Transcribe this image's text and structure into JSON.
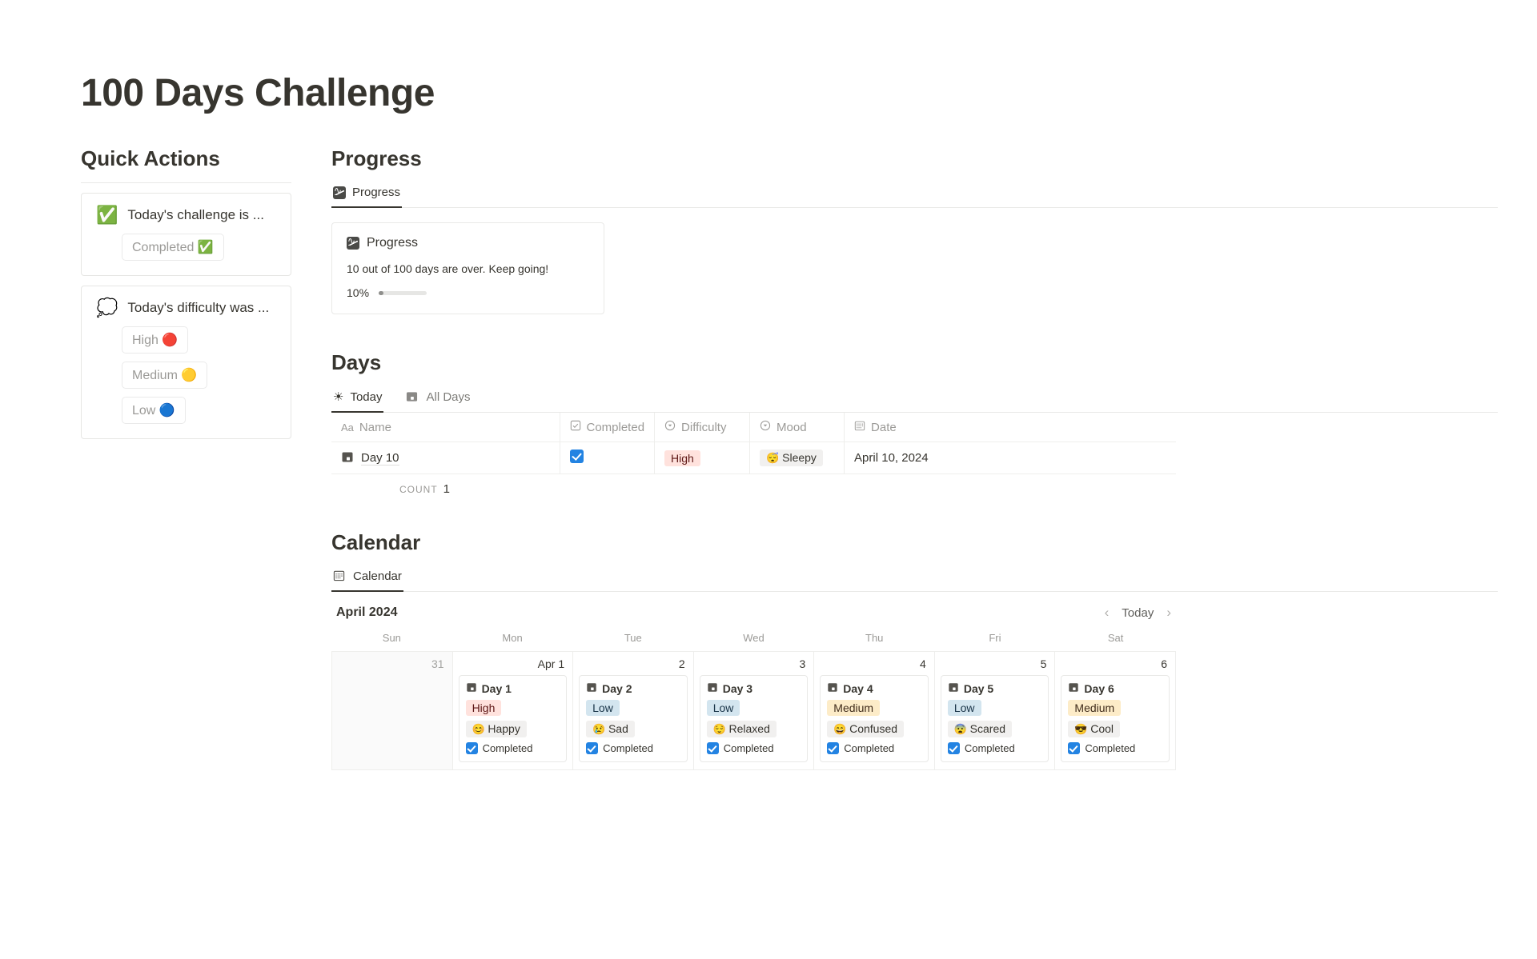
{
  "page_title": "100 Days Challenge",
  "quick_actions": {
    "heading": "Quick Actions",
    "cards": [
      {
        "emoji": "✅",
        "icon_name": "check-mark-emoji",
        "title": "Today's challenge is ...",
        "buttons": [
          {
            "label": "Completed ✅"
          }
        ]
      },
      {
        "emoji": "💭",
        "icon_name": "thought-balloon-emoji",
        "title": "Today's difficulty was ...",
        "buttons": [
          {
            "label": "High 🔴"
          },
          {
            "label": "Medium 🟡"
          },
          {
            "label": "Low 🔵"
          }
        ]
      }
    ]
  },
  "progress": {
    "heading": "Progress",
    "tabs": [
      {
        "label": "Progress",
        "icon": "chart-icon",
        "active": true
      }
    ],
    "card": {
      "title": "Progress",
      "icon": "chart-icon",
      "description": "10 out of 100 days are over. Keep going!",
      "percent_label": "10%",
      "percent_value": 10
    }
  },
  "days": {
    "heading": "Days",
    "tabs": [
      {
        "label": "Today",
        "icon": "sun-icon",
        "active": true
      },
      {
        "label": "All Days",
        "icon": "calendar-icon",
        "active": false
      }
    ],
    "columns": [
      {
        "label": "Name",
        "icon": "text-icon"
      },
      {
        "label": "Completed",
        "icon": "checkbox-icon"
      },
      {
        "label": "Difficulty",
        "icon": "select-icon"
      },
      {
        "label": "Mood",
        "icon": "select-icon"
      },
      {
        "label": "Date",
        "icon": "calendar-icon"
      }
    ],
    "rows": [
      {
        "name": "Day 10",
        "completed": true,
        "difficulty": "High",
        "difficulty_style": "high",
        "mood_emoji": "😴",
        "mood": "Sleepy",
        "date": "April 10, 2024"
      }
    ],
    "count_label": "COUNT",
    "count_value": "1"
  },
  "calendar": {
    "heading": "Calendar",
    "tabs": [
      {
        "label": "Calendar",
        "icon": "calendar-icon",
        "active": true
      }
    ],
    "month": "April 2024",
    "nav": {
      "prev": "‹",
      "today": "Today",
      "next": "›"
    },
    "dow": [
      "Sun",
      "Mon",
      "Tue",
      "Wed",
      "Thu",
      "Fri",
      "Sat"
    ],
    "cells": [
      {
        "daynum": "31",
        "outside": true,
        "event": null
      },
      {
        "daynum": "Apr 1",
        "outside": false,
        "event": {
          "title": "Day 1",
          "difficulty": "High",
          "difficulty_style": "high",
          "mood_emoji": "😊",
          "mood": "Happy",
          "completed_label": "Completed"
        }
      },
      {
        "daynum": "2",
        "outside": false,
        "event": {
          "title": "Day 2",
          "difficulty": "Low",
          "difficulty_style": "low",
          "mood_emoji": "😢",
          "mood": "Sad",
          "completed_label": "Completed"
        }
      },
      {
        "daynum": "3",
        "outside": false,
        "event": {
          "title": "Day 3",
          "difficulty": "Low",
          "difficulty_style": "low",
          "mood_emoji": "😌",
          "mood": "Relaxed",
          "completed_label": "Completed"
        }
      },
      {
        "daynum": "4",
        "outside": false,
        "event": {
          "title": "Day 4",
          "difficulty": "Medium",
          "difficulty_style": "medium",
          "mood_emoji": "😄",
          "mood": "Confused",
          "completed_label": "Completed"
        }
      },
      {
        "daynum": "5",
        "outside": false,
        "event": {
          "title": "Day 5",
          "difficulty": "Low",
          "difficulty_style": "low",
          "mood_emoji": "😨",
          "mood": "Scared",
          "completed_label": "Completed"
        }
      },
      {
        "daynum": "6",
        "outside": false,
        "event": {
          "title": "Day 6",
          "difficulty": "Medium",
          "difficulty_style": "medium",
          "mood_emoji": "😎",
          "mood": "Cool",
          "completed_label": "Completed"
        }
      }
    ]
  },
  "colors": {
    "text": "#37352f",
    "muted": "#9b9a97",
    "accent_blue": "#2383e2",
    "pill_high_bg": "#ffe2dd",
    "pill_low_bg": "#d3e5ef",
    "pill_medium_bg": "#fdecc8"
  }
}
